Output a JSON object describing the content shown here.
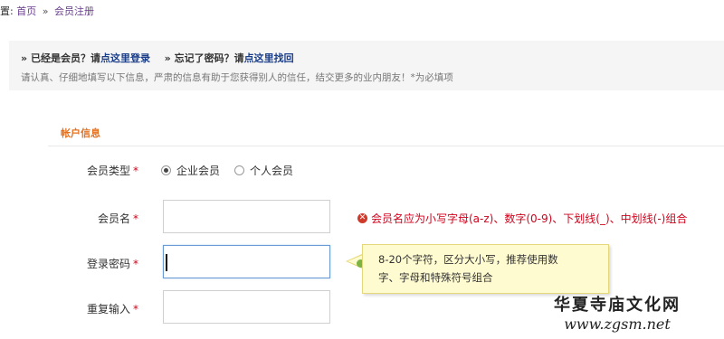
{
  "breadcrumb": {
    "prefix": "置:",
    "home": "首页",
    "separator": "»",
    "current": "会员注册"
  },
  "notice": {
    "marker1": "»",
    "already_member": "已经是会员？请",
    "login_link": "点这里登录",
    "marker2": "»",
    "forgot_password": "忘记了密码？请",
    "recover_link": "点这里找回",
    "description": "请认真、仔细地填写以下信息，严肃的信息有助于您获得别人的信任，结交更多的业内朋友！*为必填项"
  },
  "section": {
    "title": "帐户信息"
  },
  "form": {
    "member_type_label": "会员类型",
    "required_mark": "*",
    "member_type_options": [
      "企业会员",
      "个人会员"
    ],
    "member_type_selected": "企业会员",
    "username_label": "会员名",
    "username_value": "",
    "username_error": "会员名应为小写字母(a-z)、数字(0-9)、下划线(_)、中划线(-)组合",
    "password_label": "登录密码",
    "password_value": "",
    "password_hint_line1": "8-20个字符，区分大小写，推荐使用数",
    "password_hint_line2": "字、字母和特殊符号组合",
    "repeat_label": "重复输入",
    "repeat_value": ""
  },
  "watermark": {
    "title": "华夏寺庙文化网",
    "url": "www.zgsm.net"
  },
  "colors": {
    "accent": "#e4701e",
    "link": "#1a3e8a",
    "error": "#d0021b",
    "tooltip_bg": "#fffbd0"
  },
  "icons": {
    "error": "error-x-icon",
    "ok": "check-circle-icon"
  }
}
